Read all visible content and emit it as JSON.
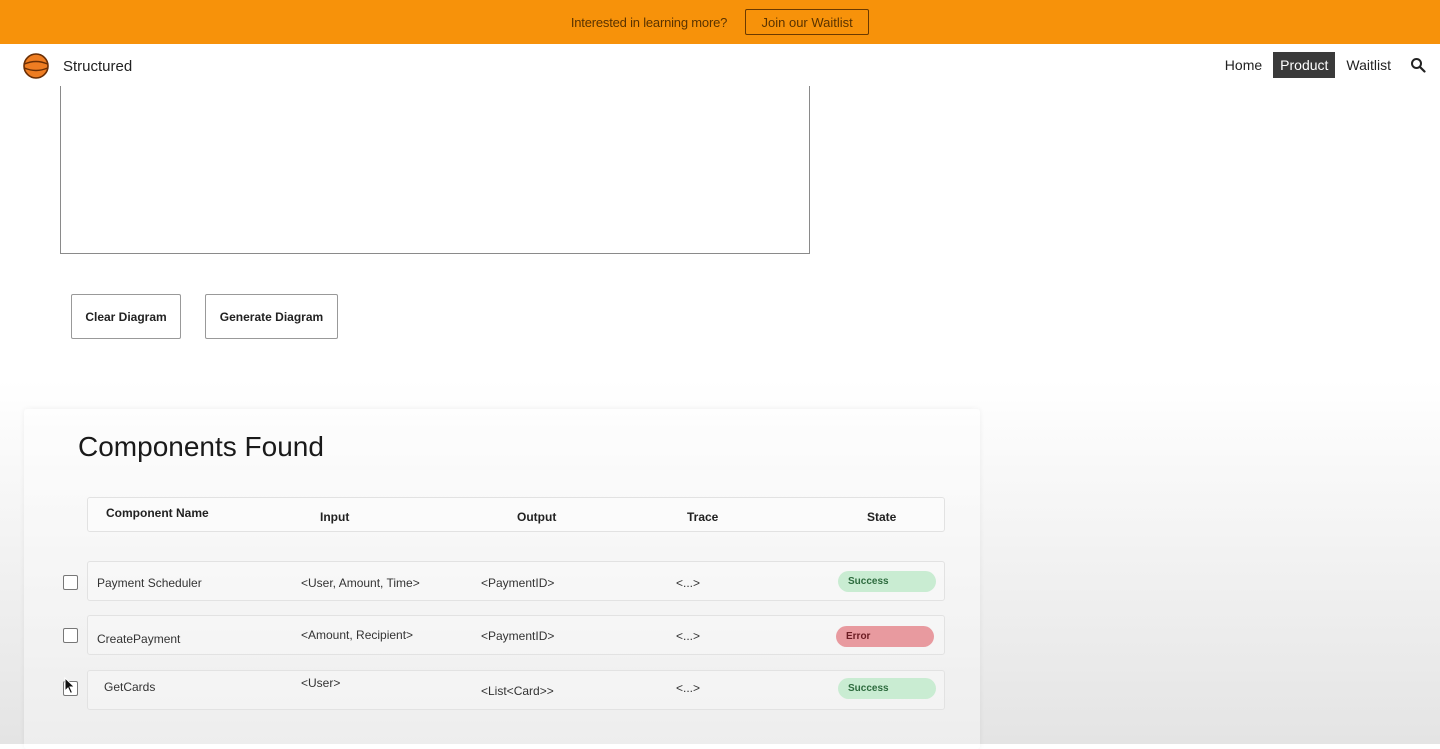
{
  "banner": {
    "text": "Interested in learning more?",
    "button_label": "Join our Waitlist",
    "color": "#f7920a"
  },
  "nav": {
    "brand": "Structured",
    "logo_icon": "basketball-logo-icon",
    "links": [
      {
        "label": "Home",
        "active": false
      },
      {
        "label": "Product",
        "active": true
      },
      {
        "label": "Waitlist",
        "active": false
      }
    ],
    "search_icon": "search-icon"
  },
  "actions": {
    "clear_label": "Clear Diagram",
    "generate_label": "Generate Diagram"
  },
  "components": {
    "title": "Components Found",
    "columns": {
      "name": "Component Name",
      "input": "Input",
      "output": "Output",
      "trace": "Trace",
      "state": "State"
    },
    "rows": [
      {
        "name": "Payment Scheduler",
        "input": "<User, Amount, Time>",
        "output": "<PaymentID>",
        "trace": "<...>",
        "state": "Success",
        "checked": false
      },
      {
        "name": "CreatePayment",
        "input": "<Amount, Recipient>",
        "output": "<PaymentID>",
        "trace": "<...>",
        "state": "Error",
        "checked": false
      },
      {
        "name": "GetCards",
        "input": "<User>",
        "output": "<List<Card>>",
        "trace": "<...>",
        "state": "Success",
        "checked": false
      }
    ],
    "state_colors": {
      "success": "#c9ecd2",
      "error": "#e89a9f"
    }
  }
}
